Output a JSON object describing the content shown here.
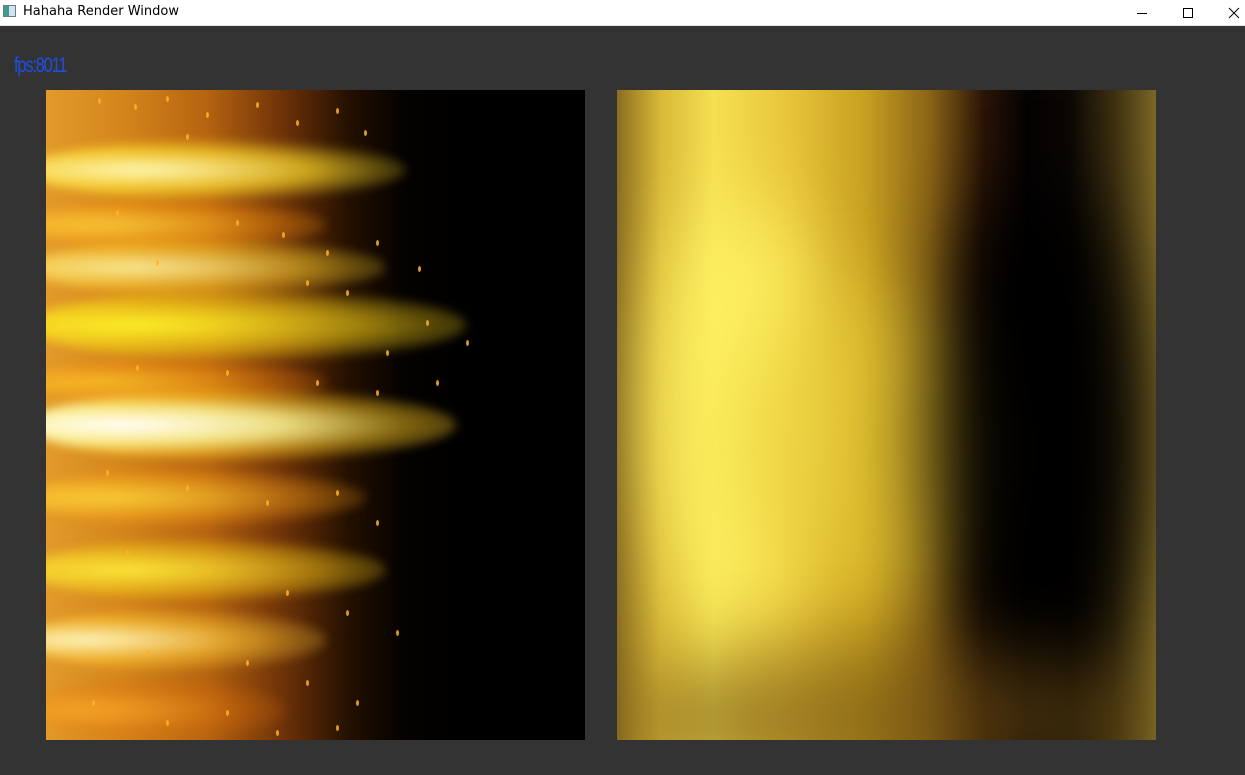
{
  "window": {
    "title": "Hahaha Render Window",
    "controls": {
      "minimize": "minimize-icon",
      "maximize": "maximize-icon",
      "close": "close-icon"
    }
  },
  "overlay": {
    "fps_text": "fps:8011",
    "fps_color": "#1f4ee6"
  },
  "viewports": [
    {
      "name": "left-render-view",
      "content": "glowing streak texture (yellow/orange on black)"
    },
    {
      "name": "right-render-view",
      "content": "blurred yellow/black gradient texture"
    }
  ],
  "colors": {
    "client_background": "#333333",
    "titlebar_background": "#ffffff"
  }
}
